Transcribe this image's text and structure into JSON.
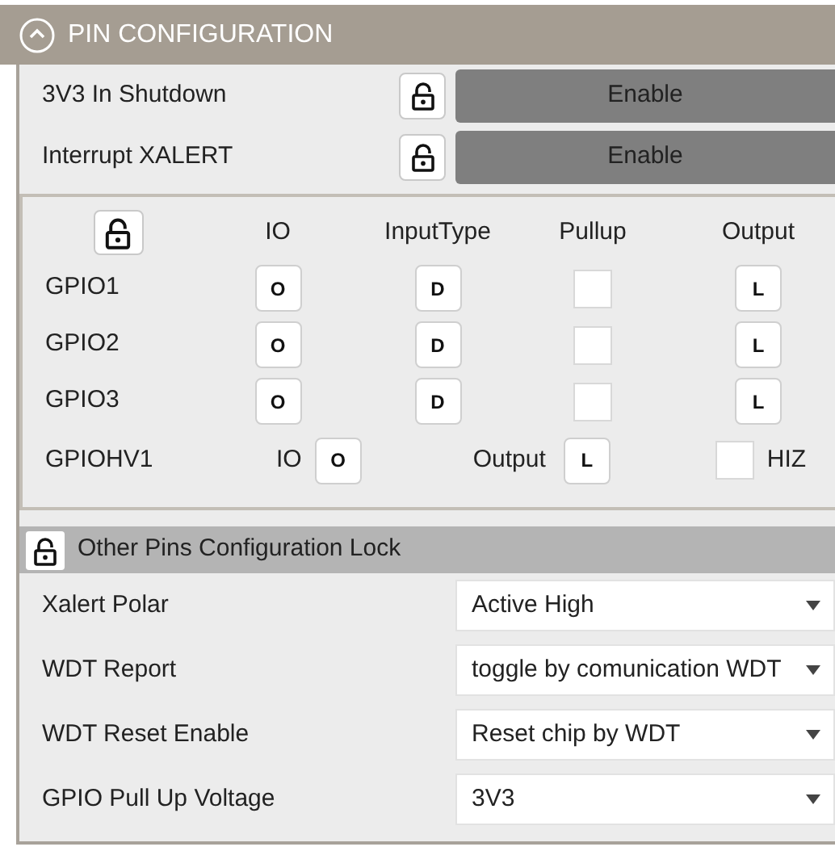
{
  "panel": {
    "title": "PIN CONFIGURATION",
    "expanded": true
  },
  "enable_rows": [
    {
      "label": "3V3 In Shutdown",
      "locked": false,
      "button": "Enable"
    },
    {
      "label": "Interrupt XALERT",
      "locked": false,
      "button": "Enable"
    }
  ],
  "gpio": {
    "locked": false,
    "columns": [
      "IO",
      "InputType",
      "Pullup",
      "Output"
    ],
    "rows": [
      {
        "name": "GPIO1",
        "io": "O",
        "input_type": "D",
        "pullup": false,
        "output": "L"
      },
      {
        "name": "GPIO2",
        "io": "O",
        "input_type": "D",
        "pullup": false,
        "output": "L"
      },
      {
        "name": "GPIO3",
        "io": "O",
        "input_type": "D",
        "pullup": false,
        "output": "L"
      }
    ],
    "hv": {
      "name": "GPIOHV1",
      "io_label": "IO",
      "io": "O",
      "output_label": "Output",
      "output": "L",
      "hiz": false,
      "hiz_label": "HIZ"
    }
  },
  "other": {
    "title": "Other Pins Configuration Lock",
    "locked": false,
    "settings": [
      {
        "label": "Xalert Polar",
        "value": "Active High"
      },
      {
        "label": "WDT Report",
        "value": "toggle by comunication WDT"
      },
      {
        "label": "WDT Reset Enable",
        "value": "Reset chip by WDT"
      },
      {
        "label": "GPIO Pull Up Voltage",
        "value": "3V3"
      }
    ]
  }
}
